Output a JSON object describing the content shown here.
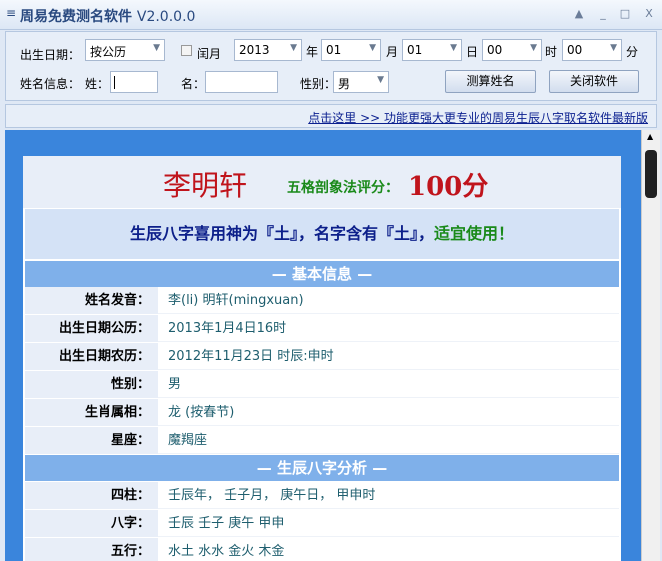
{
  "window": {
    "title": "周易免费测名软件",
    "version": "V2.0.0.0",
    "menu_icon": "≡",
    "buttons": {
      "up": "▲",
      "minimize": "_",
      "maximize": "□",
      "close": "X"
    }
  },
  "toolbar": {
    "birth_label": "出生日期：",
    "calendar": "按公历",
    "leap_label": "闰月",
    "leap_checked": false,
    "year": "2013",
    "year_unit": "年",
    "month": "01",
    "month_unit": "月",
    "day": "01",
    "day_unit": "日",
    "hour": "00",
    "hour_unit": "时",
    "minute": "00",
    "minute_unit": "分",
    "name_label": "姓名信息：",
    "surname_label": "姓：",
    "surname_value": "",
    "given_label": "名：",
    "given_value": "",
    "gender_label": "性别：",
    "gender": "男",
    "calc_button": "测算姓名",
    "close_button": "关闭软件"
  },
  "linkbar": {
    "link": "点击这里 >> 功能更强大更专业的周易生辰八字取名软件最新版"
  },
  "result": {
    "name": "李明轩",
    "score_label": "五格剖象法评分：",
    "score": "100分",
    "xys_text": "生辰八字喜用神为『土』，名字含有『土』，",
    "xys_verdict": "适宜使用！",
    "section1": "— 基本信息 —",
    "basic": [
      {
        "k": "姓名发音：",
        "v": "李(li) 明轩(mingxuan)"
      },
      {
        "k": "出生日期公历：",
        "v": "2013年1月4日16时"
      },
      {
        "k": "出生日期农历：",
        "v": "2012年11月23日 时辰:申时"
      },
      {
        "k": "性别：",
        "v": "男"
      },
      {
        "k": "生肖属相：",
        "v": "龙 (按春节)"
      },
      {
        "k": "星座：",
        "v": "魔羯座"
      }
    ],
    "section2": "— 生辰八字分析 —",
    "bazi": [
      {
        "k": "四柱：",
        "v": "壬辰年，  壬子月，  庚午日，  甲申时"
      },
      {
        "k": "八字：",
        "v": "壬辰 壬子 庚午 甲申"
      },
      {
        "k": "五行：",
        "v": "水土 水水 金火 木金"
      }
    ]
  }
}
